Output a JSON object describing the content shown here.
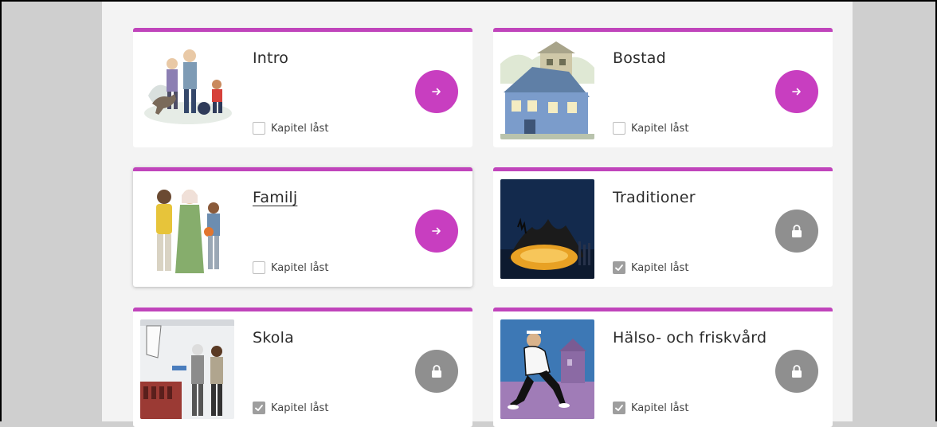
{
  "colors": {
    "accent": "#c83ec0",
    "card_border": "#c044bb",
    "locked": "#8f8f8f",
    "panel": "#f3f3f3",
    "outer": "#cfcfcf"
  },
  "chapter_lock_label": "Kapitel låst",
  "chapters": [
    {
      "title": "Intro",
      "locked": false,
      "action_icon": "arrow-right-icon",
      "image": "family-walking-dog-illustration"
    },
    {
      "title": "Bostad",
      "locked": false,
      "action_icon": "arrow-right-icon",
      "image": "blue-house-illustration"
    },
    {
      "title": "Familj",
      "locked": false,
      "action_icon": "arrow-right-icon",
      "image": "family-standing-illustration"
    },
    {
      "title": "Traditioner",
      "locked": true,
      "action_icon": "lock-icon",
      "image": "bonfire-illustration"
    },
    {
      "title": "Skola",
      "locked": true,
      "action_icon": "lock-icon",
      "image": "classroom-illustration"
    },
    {
      "title": "Hälso- och friskvård",
      "locked": true,
      "action_icon": "lock-icon",
      "image": "man-running-illustration"
    }
  ]
}
